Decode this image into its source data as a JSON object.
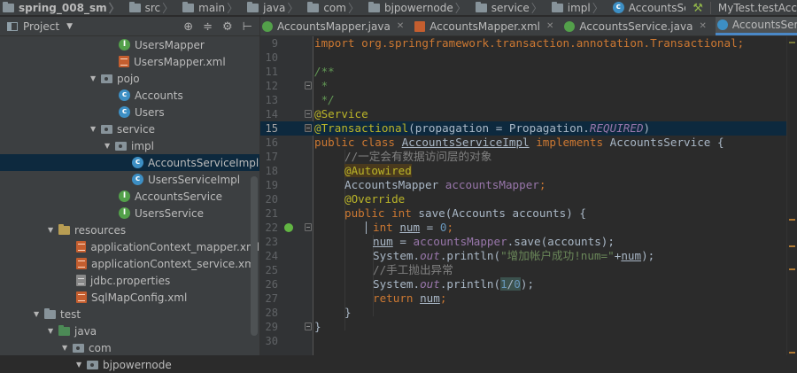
{
  "breadcrumb": {
    "items": [
      "spring_008_sm",
      "src",
      "main",
      "java",
      "com",
      "bjpowernode",
      "service",
      "impl"
    ],
    "file": "AccountsServiceImpl"
  },
  "toolbar": {
    "run_config": "MyTest.testAcc"
  },
  "project_panel": {
    "title": "Project",
    "nodes": [
      {
        "label": "UsersMapper",
        "icon": "interface"
      },
      {
        "label": "UsersMapper.xml",
        "icon": "xml"
      },
      {
        "label": "pojo",
        "icon": "package"
      },
      {
        "label": "Accounts",
        "icon": "class"
      },
      {
        "label": "Users",
        "icon": "class"
      },
      {
        "label": "service",
        "icon": "package"
      },
      {
        "label": "impl",
        "icon": "package"
      },
      {
        "label": "AccountsServiceImpl",
        "icon": "class"
      },
      {
        "label": "UsersServiceImpl",
        "icon": "class"
      },
      {
        "label": "AccountsService",
        "icon": "interface"
      },
      {
        "label": "UsersService",
        "icon": "interface"
      },
      {
        "label": "resources",
        "icon": "folder-resources"
      },
      {
        "label": "applicationContext_mapper.xml",
        "icon": "xml"
      },
      {
        "label": "applicationContext_service.xml",
        "icon": "xml"
      },
      {
        "label": "jdbc.properties",
        "icon": "properties"
      },
      {
        "label": "SqlMapConfig.xml",
        "icon": "xml"
      },
      {
        "label": "test",
        "icon": "folder"
      },
      {
        "label": "java",
        "icon": "folder-test"
      },
      {
        "label": "com",
        "icon": "package"
      },
      {
        "label": "bjpowernode",
        "icon": "package"
      }
    ]
  },
  "tabs": [
    {
      "label": "AccountsMapper.java",
      "icon": "interface"
    },
    {
      "label": "AccountsMapper.xml",
      "icon": "xml"
    },
    {
      "label": "AccountsService.java",
      "icon": "interface"
    },
    {
      "label": "AccountsServiceImpl.java",
      "icon": "class"
    }
  ],
  "editor": {
    "line_numbers": [
      "9",
      "10",
      "11",
      "12",
      "13",
      "14",
      "15",
      "16",
      "17",
      "18",
      "19",
      "20",
      "21",
      "22",
      "23",
      "24",
      "25",
      "26",
      "27",
      "28",
      "29",
      "30"
    ],
    "current_line": "15",
    "code": {
      "l9": "import org.springframework.transaction.annotation.Transactional;",
      "l11": "/**",
      "l12": " *",
      "l13": " */",
      "l14_at": "@",
      "l14_rest": "Service",
      "l15_ann": "@Transactional",
      "l15_args": "(propagation = Propagation.",
      "l15_const": "REQUIRED",
      "l15_end": ")",
      "l16_kw1": "public class ",
      "l16_name": "AccountsServiceImpl",
      "l16_kw2": " implements ",
      "l16_rest": "AccountsService {",
      "l17": "//一定会有数据访问层的对象",
      "l18": "@Autowired",
      "l19_type": "AccountsMapper ",
      "l19_field": "accountsMapper",
      "l19_end": ";",
      "l20": "@Override",
      "l21_kw": "public int ",
      "l21_rest": "save(Accounts accounts) {",
      "l22_kw": "int ",
      "l22_var": "num",
      "l22_rest": " = ",
      "l22_num": "0",
      "l22_end": ";",
      "l23_var": "num",
      "l23_mid": " = ",
      "l23_field": "accountsMapper",
      "l23_rest": ".save(accounts);",
      "l24_a": "System.",
      "l24_out": "out",
      "l24_b": ".println(",
      "l24_str": "\"增加帐户成功!num=\"",
      "l24_c": "+",
      "l24_var": "num",
      "l24_end": ");",
      "l25": "//手工抛出异常",
      "l26_a": "System.",
      "l26_out": "out",
      "l26_b": ".println(",
      "l26_one": "1",
      "l26_slash": "/",
      "l26_zero": "0",
      "l26_end": ");",
      "l27_kw": "return ",
      "l27_var": "num",
      "l27_end": ";",
      "l28": "}",
      "l29": "}"
    }
  },
  "colors": {
    "keyword": "#cc7832",
    "annotation": "#bbb529",
    "field": "#9876aa",
    "comment": "#808080",
    "string": "#6a8759",
    "selection": "#0d293e"
  }
}
